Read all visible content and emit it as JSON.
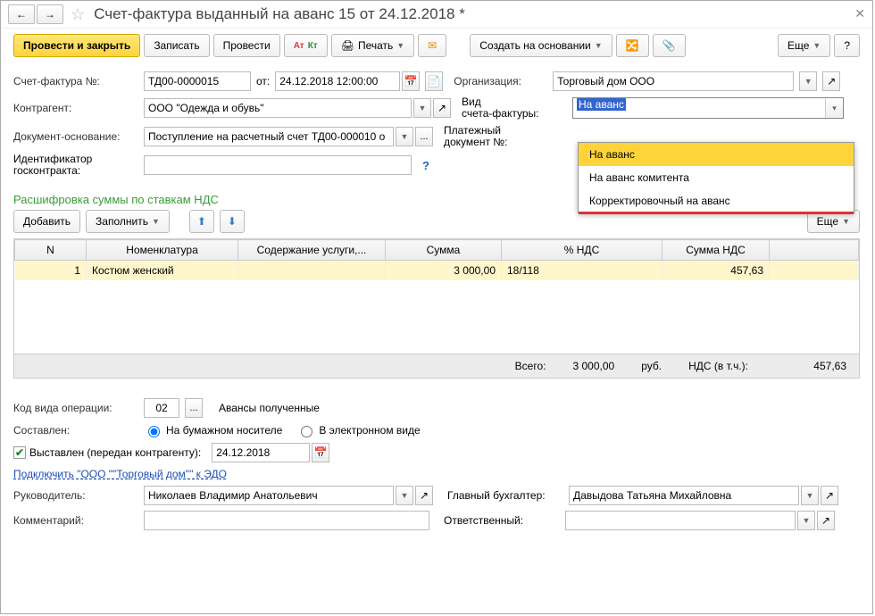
{
  "title": "Счет-фактура выданный на аванс 15 от 24.12.2018 *",
  "toolbar": {
    "postAndClose": "Провести и закрыть",
    "save": "Записать",
    "post": "Провести",
    "print": "Печать",
    "createBased": "Создать на основании",
    "more": "Еще",
    "help": "?"
  },
  "fields": {
    "invoiceNoLbl": "Счет-фактура №:",
    "invoiceNo": "ТД00-0000015",
    "fromLbl": "от:",
    "date": "24.12.2018 12:00:00",
    "orgLbl": "Организация:",
    "org": "Торговый дом ООО",
    "counterpartyLbl": "Контрагент:",
    "counterparty": "ООО \"Одежда и обувь\"",
    "invoiceTypeLbl1": "Вид",
    "invoiceTypeLbl2": "счета-фактуры:",
    "invoiceType": "На аванс",
    "docBasisLbl": "Документ-основание:",
    "docBasis": "Поступление на расчетный счет ТД00-000010 о",
    "payDocLbl1": "Платежный",
    "payDocLbl2": "документ №:",
    "govIdLbl1": "Идентификатор",
    "govIdLbl2": "госконтракта:"
  },
  "dropdown": {
    "opt1": "На аванс",
    "opt2": "На аванс комитента",
    "opt3": "Корректировочный на аванс"
  },
  "sectionTitle": "Расшифровка суммы по ставкам НДС",
  "tableButtons": {
    "add": "Добавить",
    "fill": "Заполнить",
    "more": "Еще"
  },
  "tableHead": {
    "n": "N",
    "item": "Номенклатура",
    "desc": "Содержание услуги,...",
    "sum": "Сумма",
    "vatRate": "% НДС",
    "vatSum": "Сумма НДС"
  },
  "tableRow": {
    "n": "1",
    "item": "Костюм женский",
    "sum": "3 000,00",
    "vatRate": "18/118",
    "vatSum": "457,63"
  },
  "totals": {
    "totalLbl": "Всего:",
    "total": "3 000,00",
    "rub": "руб.",
    "vatLbl": "НДС (в т.ч.):",
    "vat": "457,63"
  },
  "bottom": {
    "opCodeLbl": "Код вида операции:",
    "opCode": "02",
    "opCodeDesc": "Авансы полученные",
    "composedLbl": "Составлен:",
    "composedPaper": "На бумажном носителе",
    "composedElec": "В электронном виде",
    "issuedCheck": "Выставлен (передан контрагенту):",
    "issuedDate": "24.12.2018",
    "edoLink": "Подключить \"ООО \"\"Торговый дом\"\" к ЭДО",
    "directorLbl": "Руководитель:",
    "director": "Николаев Владимир Анатольевич",
    "accountantLbl": "Главный бухгалтер:",
    "accountant": "Давыдова Татьяна Михайловна",
    "commentLbl": "Комментарий:",
    "responsibleLbl": "Ответственный:"
  }
}
